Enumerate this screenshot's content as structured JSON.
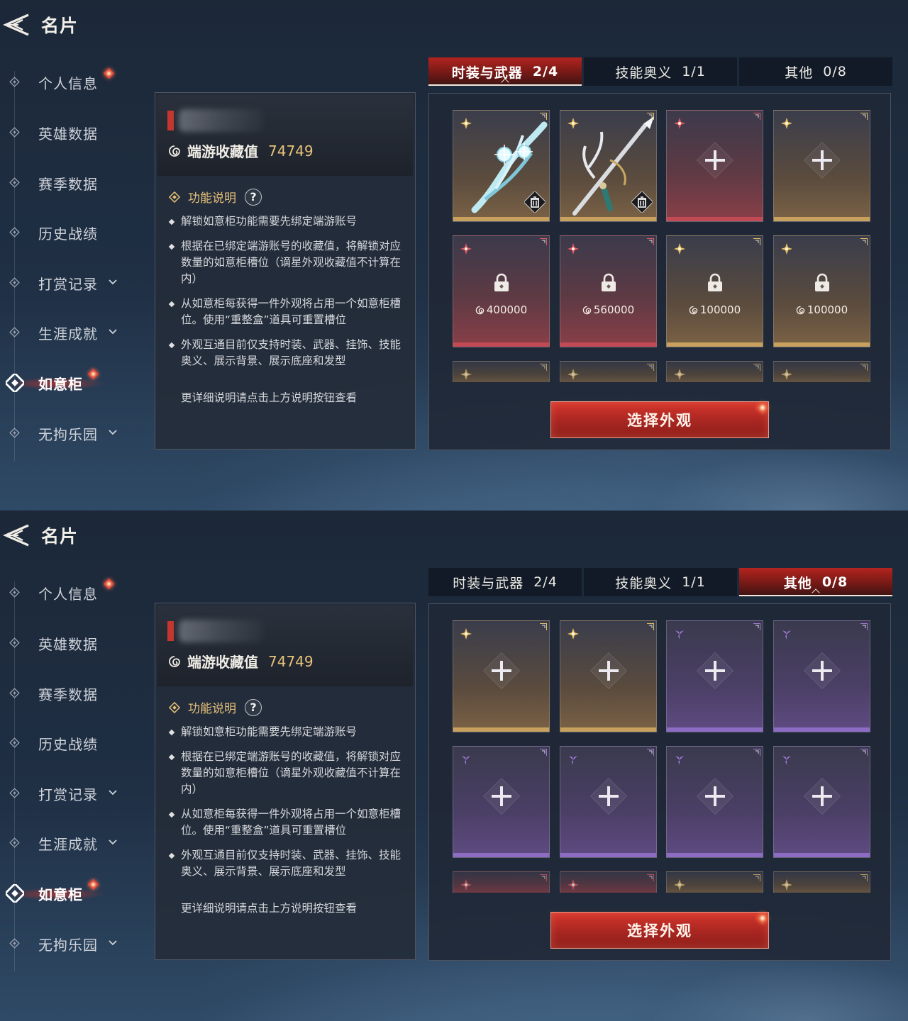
{
  "screens": [
    {
      "header": {
        "title": "名片"
      },
      "sidebar": {
        "items": [
          {
            "label": "个人信息",
            "badge": true,
            "chevron": false,
            "active": false
          },
          {
            "label": "英雄数据",
            "badge": false,
            "chevron": false,
            "active": false
          },
          {
            "label": "赛季数据",
            "badge": false,
            "chevron": false,
            "active": false
          },
          {
            "label": "历史战绩",
            "badge": false,
            "chevron": false,
            "active": false
          },
          {
            "label": "打赏记录",
            "badge": false,
            "chevron": true,
            "active": false
          },
          {
            "label": "生涯成就",
            "badge": false,
            "chevron": true,
            "active": false
          },
          {
            "label": "如意柜",
            "badge": true,
            "chevron": false,
            "active": true
          },
          {
            "label": "无拘乐园",
            "badge": false,
            "chevron": true,
            "active": false
          }
        ]
      },
      "info": {
        "collect_label": "端游收藏值",
        "collect_value": "74749",
        "func_title": "功能说明",
        "help": "?",
        "bullets": [
          "解锁如意柜功能需要先绑定端游账号",
          "根据在已绑定端游账号的收藏值，将解锁对应数量的如意柜槽位（谪星外观收藏值不计算在内）",
          "从如意柜每获得一件外观将占用一个如意柜槽位。使用“重整盒”道具可重置槽位",
          "外观互通目前仅支持时装、武器、挂饰、技能奥义、展示背景、展示底座和发型"
        ],
        "footer": "更详细说明请点击上方说明按钮查看"
      },
      "tabs": [
        {
          "label": "时装与武器",
          "count": "2/4",
          "active": true
        },
        {
          "label": "技能奥义",
          "count": "1/1",
          "active": false
        },
        {
          "label": "其他",
          "count": "0/8",
          "active": false
        }
      ],
      "slots": [
        {
          "tier": "gold",
          "state": "item",
          "item": "ice-blade"
        },
        {
          "tier": "gold",
          "state": "item",
          "item": "spear"
        },
        {
          "tier": "red",
          "state": "empty"
        },
        {
          "tier": "gold",
          "state": "empty"
        },
        {
          "tier": "red",
          "state": "locked",
          "price": "400000"
        },
        {
          "tier": "red",
          "state": "locked",
          "price": "560000"
        },
        {
          "tier": "gold",
          "state": "locked",
          "price": "100000"
        },
        {
          "tier": "gold",
          "state": "locked",
          "price": "100000"
        },
        {
          "tier": "gold",
          "state": "partial"
        },
        {
          "tier": "gold",
          "state": "partial"
        },
        {
          "tier": "gold",
          "state": "partial"
        },
        {
          "tier": "gold",
          "state": "partial"
        }
      ],
      "button": {
        "label": "选择外观"
      }
    },
    {
      "header": {
        "title": "名片"
      },
      "sidebar": {
        "items": [
          {
            "label": "个人信息",
            "badge": true,
            "chevron": false,
            "active": false
          },
          {
            "label": "英雄数据",
            "badge": false,
            "chevron": false,
            "active": false
          },
          {
            "label": "赛季数据",
            "badge": false,
            "chevron": false,
            "active": false
          },
          {
            "label": "历史战绩",
            "badge": false,
            "chevron": false,
            "active": false
          },
          {
            "label": "打赏记录",
            "badge": false,
            "chevron": true,
            "active": false
          },
          {
            "label": "生涯成就",
            "badge": false,
            "chevron": true,
            "active": false
          },
          {
            "label": "如意柜",
            "badge": true,
            "chevron": false,
            "active": true
          },
          {
            "label": "无拘乐园",
            "badge": false,
            "chevron": true,
            "active": false
          }
        ]
      },
      "info": {
        "collect_label": "端游收藏值",
        "collect_value": "74749",
        "func_title": "功能说明",
        "help": "?",
        "bullets": [
          "解锁如意柜功能需要先绑定端游账号",
          "根据在已绑定端游账号的收藏值，将解锁对应数量的如意柜槽位（谪星外观收藏值不计算在内）",
          "从如意柜每获得一件外观将占用一个如意柜槽位。使用“重整盒”道具可重置槽位",
          "外观互通目前仅支持时装、武器、挂饰、技能奥义、展示背景、展示底座和发型"
        ],
        "footer": "更详细说明请点击上方说明按钮查看"
      },
      "tabs": [
        {
          "label": "时装与武器",
          "count": "2/4",
          "active": false
        },
        {
          "label": "技能奥义",
          "count": "1/1",
          "active": false
        },
        {
          "label": "其他",
          "count": "0/8",
          "active": true
        }
      ],
      "slots": [
        {
          "tier": "gold",
          "state": "empty"
        },
        {
          "tier": "gold",
          "state": "empty"
        },
        {
          "tier": "purple",
          "state": "empty"
        },
        {
          "tier": "purple",
          "state": "empty"
        },
        {
          "tier": "purple",
          "state": "empty"
        },
        {
          "tier": "purple",
          "state": "empty"
        },
        {
          "tier": "purple",
          "state": "empty"
        },
        {
          "tier": "purple",
          "state": "empty"
        },
        {
          "tier": "red",
          "state": "partial"
        },
        {
          "tier": "red",
          "state": "partial"
        },
        {
          "tier": "gold",
          "state": "partial"
        },
        {
          "tier": "gold",
          "state": "partial"
        }
      ],
      "button": {
        "label": "选择外观"
      }
    }
  ]
}
